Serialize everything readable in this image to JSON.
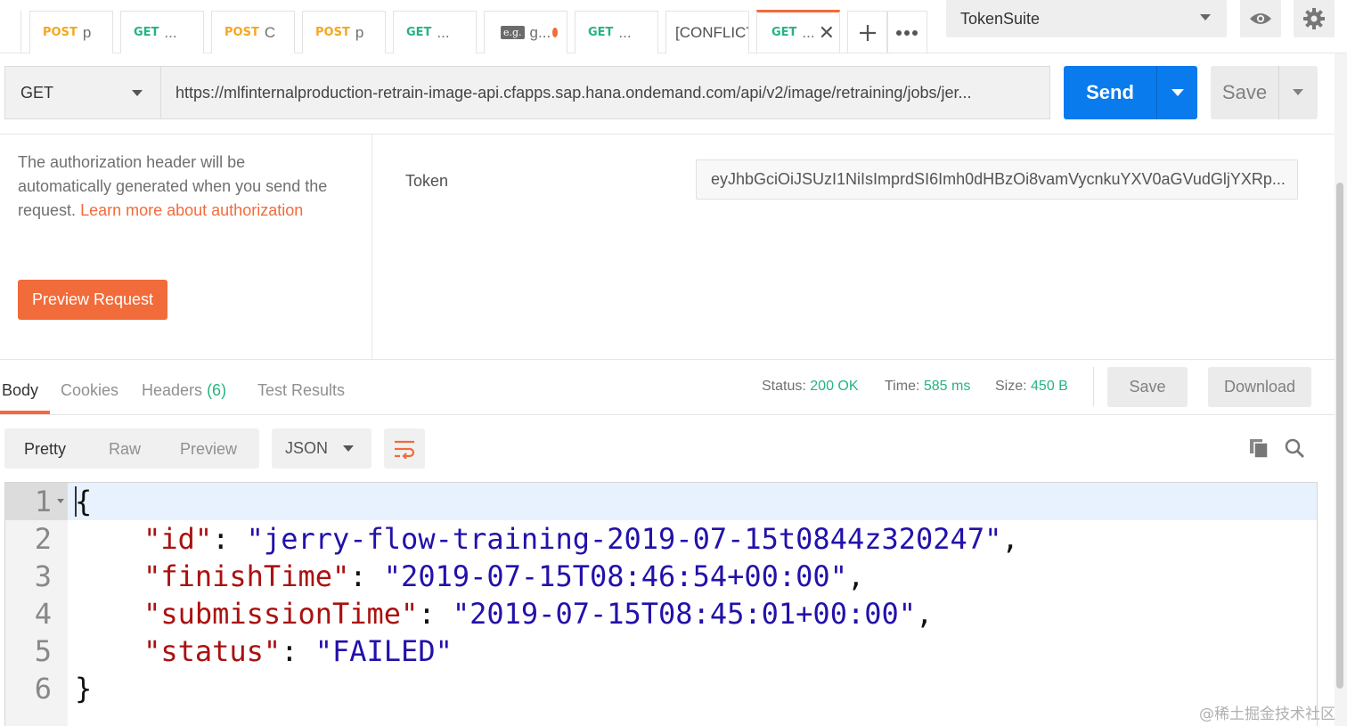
{
  "tabs": [
    {
      "method": "POST",
      "name": "p"
    },
    {
      "method": "GET",
      "name": "..."
    },
    {
      "method": "POST",
      "name": "C"
    },
    {
      "method": "POST",
      "name": "p"
    },
    {
      "method": "GET",
      "name": "..."
    },
    {
      "badge": "e.g.",
      "name": "g...",
      "unsaved": true
    },
    {
      "method": "GET",
      "name": "..."
    },
    {
      "name": "[CONFLICT"
    },
    {
      "method": "GET",
      "name": "...",
      "active": true
    }
  ],
  "environment": {
    "selected": "TokenSuite"
  },
  "request": {
    "method": "GET",
    "url": "https://mlfinternalproduction-retrain-image-api.cfapps.sap.hana.ondemand.com/api/v2/image/retraining/jobs/jer...",
    "send_label": "Send",
    "save_label": "Save"
  },
  "auth": {
    "description": "The authorization header will be automatically generated when you send the request.",
    "learn_more": "Learn more about authorization",
    "preview_label": "Preview Request",
    "token_label": "Token",
    "token_value": "eyJhbGciOiJSUzI1NiIsImprdSI6Imh0dHBzOi8vamVycnkuYXV0aGVudGljYXRp..."
  },
  "response": {
    "tabs": {
      "body": "Body",
      "cookies": "Cookies",
      "headers": "Headers",
      "headers_count": "(6)",
      "test_results": "Test Results"
    },
    "status_label": "Status:",
    "status_value": "200 OK",
    "time_label": "Time:",
    "time_value": "585 ms",
    "size_label": "Size:",
    "size_value": "450 B",
    "save_label": "Save",
    "download_label": "Download",
    "formats": {
      "pretty": "Pretty",
      "raw": "Raw",
      "preview": "Preview"
    },
    "language": "JSON",
    "body": {
      "l1": "{",
      "id_key": "\"id\"",
      "id_val": "\"jerry-flow-training-2019-07-15t0844z320247\"",
      "finish_key": "\"finishTime\"",
      "finish_val": "\"2019-07-15T08:46:54+00:00\"",
      "submission_key": "\"submissionTime\"",
      "submission_val": "\"2019-07-15T08:45:01+00:00\"",
      "status_key": "\"status\"",
      "status_val": "\"FAILED\"",
      "l6": "}"
    },
    "line_numbers": [
      "1",
      "2",
      "3",
      "4",
      "5",
      "6"
    ]
  },
  "watermark": "@稀土掘金技术社区",
  "colors": {
    "accent": "#f26b3a",
    "send": "#097bed",
    "get": "#26b47f",
    "post": "#f5a623"
  }
}
